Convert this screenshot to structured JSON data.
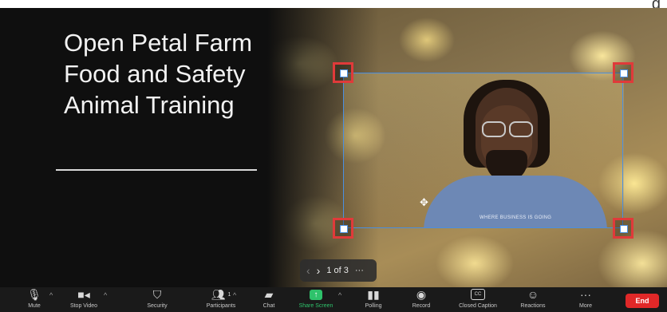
{
  "corner_text": "g",
  "slide": {
    "title": "Open Petal Farm Food and Safety Animal Training",
    "shirt_text": "WHERE BUSINESS IS GOING"
  },
  "pager": {
    "prev_icon": "chevron-left-icon",
    "next_icon": "chevron-right-icon",
    "page_label": "1 of 3",
    "more_label": "···"
  },
  "toolbar": {
    "mute": "Mute",
    "stop_video": "Stop Video",
    "security": "Security",
    "participants": "Participants",
    "participants_count": "1",
    "chat": "Chat",
    "share_screen": "Share Screen",
    "polling": "Polling",
    "record": "Record",
    "closed_caption": "Closed Caption",
    "cc_badge": "CC",
    "reactions": "Reactions",
    "more": "More",
    "end": "End"
  },
  "colors": {
    "share_accent": "#2ec26b",
    "end_button": "#e02828",
    "handle_border": "#e03a3a",
    "selection_border": "#4a8fe0"
  }
}
